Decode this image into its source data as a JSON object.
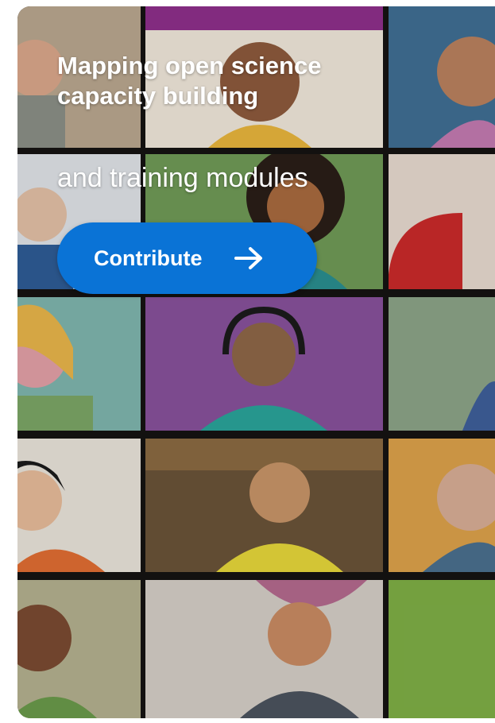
{
  "hero": {
    "title_lines": [
      "Mapping open science",
      "capacity building"
    ],
    "subtitle": "and training modules",
    "cta_label": "Contribute",
    "cta_icon": "arrow-right-icon",
    "accent_color": "#0a73d6"
  }
}
